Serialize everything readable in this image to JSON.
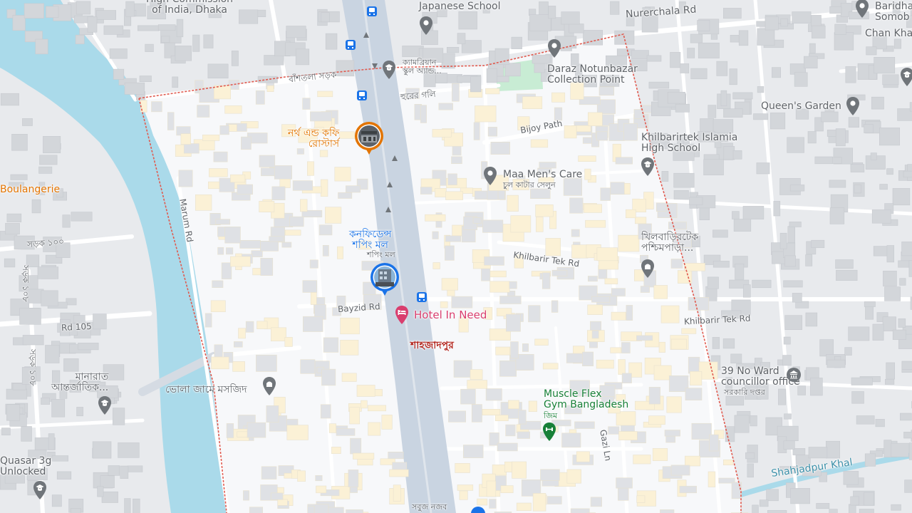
{
  "map": {
    "colors": {
      "land": "#e8eaed",
      "highlight_area": "#f8f9fa",
      "water": "#aadaea",
      "road": "#ffffff",
      "main_road": "#c9d4e1",
      "building": "#d7d9dd",
      "building_yellow": "#fbf1d6",
      "park": "#c8ecd4",
      "boundary": "#e05a4f",
      "poi_grey": "#70757a",
      "poi_blue": "#1a73e8",
      "poi_orange": "#e37400",
      "poi_green": "#188038",
      "poi_pink": "#d93e6e"
    },
    "labels": {
      "high_commission": "High Commission\nof India, Dhaka",
      "japanese_school": "Japanese School",
      "nurerchala_rd": "Nurerchala Rd",
      "baridhara_somobay": "Baridha\nSomob",
      "chan_khan": "Chan Kha",
      "daraz": "Daraz Notunbazar\nCollection Point",
      "cambrian_school": "ক্যামব্রিয়ান\nস্কুল অ্যান্ড...",
      "bashtola_sarak": "বাঁশতলা সড়ক",
      "hurer_goli": "হুরের গলি",
      "queens_garden": "Queen's Garden",
      "north_end_coffee": "নর্থ এন্ড কফি\nরোস্টার্স",
      "bijoy_path": "Bijoy Path",
      "khilbarirtek_school": "Khilbarirtek Islamia\nHigh School",
      "maa_mens_care": "Maa Men's Care",
      "maa_mens_care_bn": "চুল কাটার সেলুন",
      "boulangerie": "Boulangerie",
      "marum_rd": "Marum Rd",
      "confidence_mall": "কনফিডেন্স\nশপিং মল",
      "confidence_mall_sub": "শপিং মল",
      "khilbaritek_west": "খিলবাড়িরটেক\nপশ্চিমপাড়া...",
      "khilbarir_tek_rd_1": "Khilbarir Tek Rd",
      "sarak_100": "সড়ক ১০০",
      "sarak_108_left": "সড়ক ১০৮",
      "bayzid_rd": "Bayzid Rd",
      "hotel_in_need": "Hotel In Need",
      "khilbarir_tek_rd_2": "Khilbarir Tek Rd",
      "rd_105": "Rd 105",
      "shahjadpur": "শাহজাদপুর",
      "ward_39": "39 No Ward\ncouncillor office",
      "ward_39_bn": "সরকারি দপ্তর",
      "sarak_108_bottom": "সড়ক ১০৮",
      "manarat": "মানারাত\nআন্তর্জাতিক...",
      "vola_mosque": "ভোলা জামে মসজিদ",
      "muscle_flex": "Muscle Flex\nGym Bangladesh",
      "muscle_flex_bn": "জিম",
      "gazi_ln": "Gazi Ln",
      "quasar": "Quasar 3g\nUnlocked",
      "shahjadpur_khal": "Shahjadpur Khal",
      "sobuj_nagar": "সবুজ নজব"
    },
    "icons": {
      "poi_pin": "location-pin-icon",
      "school": "graduation-cap-icon",
      "temple": "temple-icon",
      "mosque": "mosque-icon",
      "hotel": "bed-icon",
      "bus_stop": "bus-icon",
      "gym": "dumbbell-icon",
      "government": "government-building-icon",
      "photo": "photo-thumbnail-icon"
    }
  }
}
